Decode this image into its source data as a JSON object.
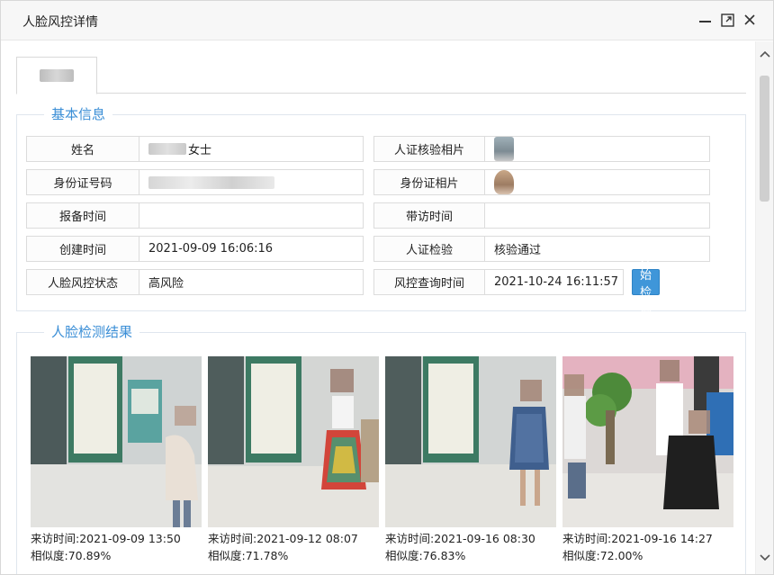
{
  "window": {
    "title": "人脸风控详情"
  },
  "sections": {
    "basic_info": "基本信息",
    "detection": "人脸检测结果"
  },
  "fields": [
    {
      "label": "姓名",
      "value": "女士"
    },
    {
      "label": "人证核验相片",
      "value": ""
    },
    {
      "label": "身份证号码",
      "value": ""
    },
    {
      "label": "身份证相片",
      "value": ""
    },
    {
      "label": "报备时间",
      "value": ""
    },
    {
      "label": "带访时间",
      "value": ""
    },
    {
      "label": "创建时间",
      "value": "2021-09-09 16:06:16"
    },
    {
      "label": "人证检验",
      "value": "核验通过"
    },
    {
      "label": "人脸风控状态",
      "value": "高风险"
    },
    {
      "label": "风控查询时间",
      "value": "2021-10-24 16:11:57"
    }
  ],
  "actions": {
    "detect_button": "开始检测"
  },
  "photos": [
    {
      "visit_time": "来访时间:2021-09-09 13:50",
      "similarity": "相似度:70.89%"
    },
    {
      "visit_time": "来访时间:2021-09-12 08:07",
      "similarity": "相似度:71.78%"
    },
    {
      "visit_time": "来访时间:2021-09-16 08:30",
      "similarity": "相似度:76.83%"
    },
    {
      "visit_time": "来访时间:2021-09-16 14:27",
      "similarity": "相似度:72.00%"
    }
  ],
  "icons": {
    "minimize": "minimize-icon",
    "maximize": "maximize-icon",
    "close": "close-icon",
    "scroll_up": "chevron-up-icon",
    "scroll_down": "chevron-down-icon"
  },
  "colors": {
    "accent": "#3a8ed6",
    "button": "#3f96d9"
  }
}
